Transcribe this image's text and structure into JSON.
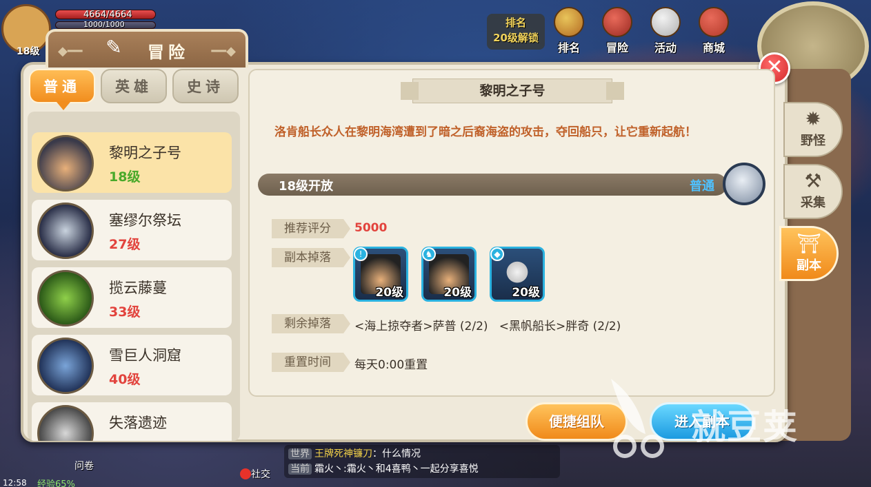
{
  "hud": {
    "level": "18级",
    "hp_text": "4664/4664",
    "mp_text": "1000/1000",
    "clock": "12:58",
    "exp": "经验65%"
  },
  "top_menu": {
    "rank_lock": {
      "line1": "排名",
      "line2": "20级解锁"
    },
    "buttons": [
      {
        "label": "排名",
        "icon": "crown-icon"
      },
      {
        "label": "冒险",
        "icon": "adventure-icon"
      },
      {
        "label": "活动",
        "icon": "event-icon"
      },
      {
        "label": "商城",
        "icon": "shop-icon"
      }
    ]
  },
  "dialog": {
    "title": "冒险",
    "close_symbol": "✕",
    "difficulty_tabs": [
      {
        "label": "普通",
        "active": true
      },
      {
        "label": "英雄",
        "active": false
      },
      {
        "label": "史诗",
        "active": false
      }
    ],
    "dungeons": [
      {
        "name": "黎明之子号",
        "level": "18级",
        "level_color": "green",
        "selected": true
      },
      {
        "name": "塞缪尔祭坛",
        "level": "27级",
        "level_color": "red",
        "selected": false
      },
      {
        "name": "揽云藤蔓",
        "level": "33级",
        "level_color": "red",
        "selected": false
      },
      {
        "name": "雪巨人洞窟",
        "level": "40级",
        "level_color": "red",
        "selected": false
      },
      {
        "name": "失落遗迹",
        "level": "",
        "level_color": "red",
        "selected": false
      }
    ],
    "detail": {
      "title": "黎明之子号",
      "description": "洛肯船长众人在黎明海湾遭到了暗之后裔海盗的攻击，夺回船只，让它重新起航！",
      "open_text": "18级开放",
      "mode": "普通",
      "recommend_label": "推荐评分",
      "recommend_value": "5000",
      "drop_label": "副本掉落",
      "drops": [
        {
          "level": "20级",
          "badge": "!"
        },
        {
          "level": "20级",
          "badge": "♞"
        },
        {
          "level": "20级",
          "badge": "◆"
        }
      ],
      "remaining_label": "剩余掉落",
      "remaining_value": "<海上掠夺者>萨普 (2/2)   <黑帆船长>胖奇 (2/2)",
      "reset_label": "重置时间",
      "reset_value": "每天0:00重置"
    },
    "buttons": {
      "quick_team": "便捷组队",
      "enter": "进入副本"
    },
    "side_tabs": [
      {
        "label": "野怪",
        "icon": "monster-icon",
        "active": false
      },
      {
        "label": "采集",
        "icon": "pickaxe-icon",
        "active": false
      },
      {
        "label": "副本",
        "icon": "dungeon-icon",
        "active": true
      }
    ]
  },
  "bottom": {
    "qa": "问卷",
    "social": "社交",
    "chat": [
      {
        "tag": "世界",
        "sender": "王牌死神镰刀",
        "text": "：什么情况"
      },
      {
        "tag": "当前",
        "text": "霜火丶:霜火丶和4喜鸭丶一起分享喜悦"
      }
    ]
  },
  "watermark": "就豆荚",
  "colors": {
    "accent_orange": "#f18d1e",
    "level_green": "#49a92a",
    "level_red": "#e2433d",
    "enter_blue": "#1b9ae0",
    "description_brown": "#c0612a"
  }
}
